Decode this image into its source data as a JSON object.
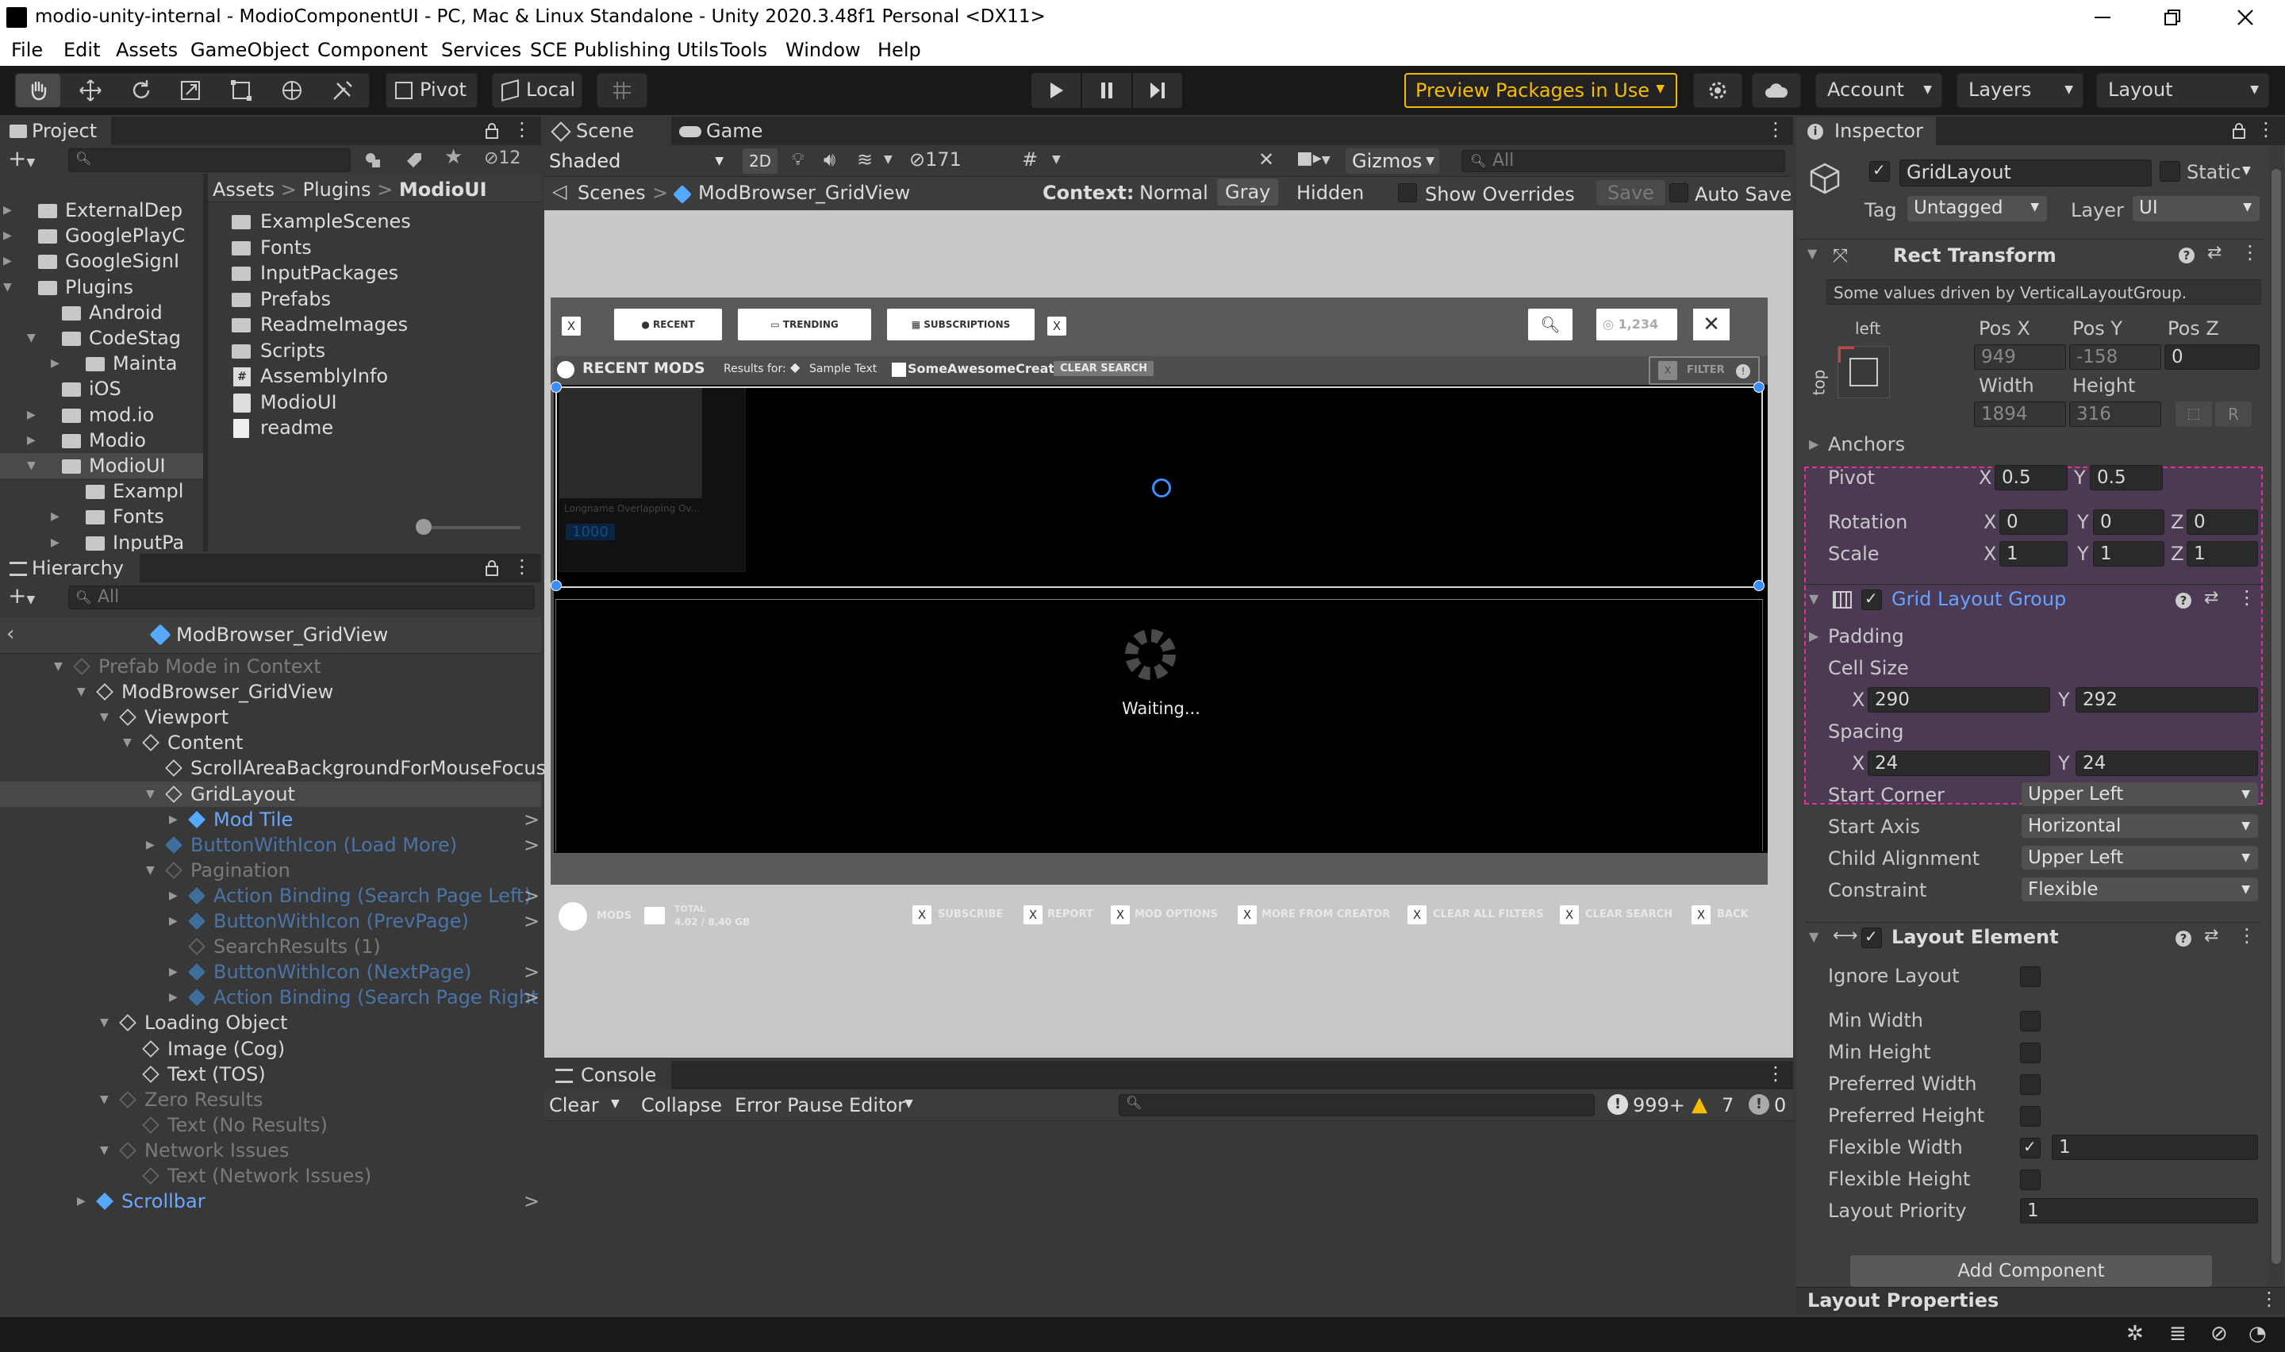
{
  "window": {
    "title": "modio-unity-internal - ModioComponentUI - PC, Mac & Linux Standalone - Unity 2020.3.48f1 Personal <DX11>"
  },
  "menu": [
    "File",
    "Edit",
    "Assets",
    "GameObject",
    "Component",
    "Services",
    "SCE Publishing Utils",
    "Tools",
    "Window",
    "Help"
  ],
  "toolbar": {
    "pivot": "Pivot",
    "local": "Local",
    "preview_packages": "Preview Packages in Use",
    "account": "Account",
    "layers": "Layers",
    "layout": "Layout",
    "accent": "#f4bc02"
  },
  "project": {
    "tab": "Project",
    "hidden_count": "12",
    "tree": [
      {
        "label": "ExternalDep",
        "indent": 0,
        "arrow": "right"
      },
      {
        "label": "GooglePlayC",
        "indent": 0,
        "arrow": "right"
      },
      {
        "label": "GoogleSignI",
        "indent": 0,
        "arrow": "right"
      },
      {
        "label": "Plugins",
        "indent": 0,
        "arrow": "down"
      },
      {
        "label": "Android",
        "indent": 1,
        "arrow": ""
      },
      {
        "label": "CodeStag",
        "indent": 1,
        "arrow": "down"
      },
      {
        "label": "Mainta",
        "indent": 2,
        "arrow": "right"
      },
      {
        "label": "iOS",
        "indent": 1,
        "arrow": ""
      },
      {
        "label": "mod.io",
        "indent": 1,
        "arrow": "right"
      },
      {
        "label": "Modio",
        "indent": 1,
        "arrow": "right"
      },
      {
        "label": "ModioUI",
        "indent": 1,
        "arrow": "down",
        "selected": true
      },
      {
        "label": "Exampl",
        "indent": 2,
        "arrow": ""
      },
      {
        "label": "Fonts",
        "indent": 2,
        "arrow": "right"
      },
      {
        "label": "InputPa",
        "indent": 2,
        "arrow": "right"
      }
    ],
    "breadcrumb": [
      "Assets",
      "Plugins",
      "ModioUI"
    ],
    "files": [
      {
        "label": "ExampleScenes",
        "icon": "folder-icon"
      },
      {
        "label": "Fonts",
        "icon": "folder-icon"
      },
      {
        "label": "InputPackages",
        "icon": "folder-icon"
      },
      {
        "label": "Prefabs",
        "icon": "folder-icon"
      },
      {
        "label": "ReadmeImages",
        "icon": "folder-icon"
      },
      {
        "label": "Scripts",
        "icon": "folder-icon"
      },
      {
        "label": "AssemblyInfo",
        "icon": "csharp-script-icon"
      },
      {
        "label": "ModioUI",
        "icon": "asset-icon"
      },
      {
        "label": "readme",
        "icon": "text-file-icon"
      }
    ]
  },
  "hierarchy": {
    "tab": "Hierarchy",
    "search_placeholder": "All",
    "root": "ModBrowser_GridView",
    "items": [
      {
        "label": "Prefab Mode in Context",
        "indent": 0,
        "arrow": "down",
        "style": "dim"
      },
      {
        "label": "ModBrowser_GridView",
        "indent": 1,
        "arrow": "down",
        "style": "normal"
      },
      {
        "label": "Viewport",
        "indent": 2,
        "arrow": "down",
        "style": "normal"
      },
      {
        "label": "Content",
        "indent": 3,
        "arrow": "down",
        "style": "normal"
      },
      {
        "label": "ScrollAreaBackgroundForMouseFocus",
        "indent": 4,
        "arrow": "",
        "style": "normal"
      },
      {
        "label": "GridLayout",
        "indent": 4,
        "arrow": "down",
        "style": "selected"
      },
      {
        "label": "Mod Tile",
        "indent": 5,
        "arrow": "right",
        "style": "prefab",
        "chev": true
      },
      {
        "label": "ButtonWithIcon (Load More)",
        "indent": 4,
        "arrow": "right",
        "style": "prefab-dim",
        "chev": true
      },
      {
        "label": "Pagination",
        "indent": 4,
        "arrow": "down",
        "style": "dim"
      },
      {
        "label": "Action Binding (Search Page Left)",
        "indent": 5,
        "arrow": "right",
        "style": "prefab-dim",
        "chev": true
      },
      {
        "label": "ButtonWithIcon (PrevPage)",
        "indent": 5,
        "arrow": "right",
        "style": "prefab-dim",
        "chev": true
      },
      {
        "label": "SearchResults (1)",
        "indent": 5,
        "arrow": "",
        "style": "dim"
      },
      {
        "label": "ButtonWithIcon (NextPage)",
        "indent": 5,
        "arrow": "right",
        "style": "prefab-dim",
        "chev": true
      },
      {
        "label": "Action Binding (Search Page Right",
        "indent": 5,
        "arrow": "right",
        "style": "prefab-dim",
        "chev": true
      },
      {
        "label": "Loading Object",
        "indent": 2,
        "arrow": "down",
        "style": "normal"
      },
      {
        "label": "Image (Cog)",
        "indent": 3,
        "arrow": "",
        "style": "normal"
      },
      {
        "label": "Text (TOS)",
        "indent": 3,
        "arrow": "",
        "style": "normal"
      },
      {
        "label": "Zero Results",
        "indent": 2,
        "arrow": "down",
        "style": "dim"
      },
      {
        "label": "Text (No Results)",
        "indent": 3,
        "arrow": "",
        "style": "dim"
      },
      {
        "label": "Network Issues",
        "indent": 2,
        "arrow": "down",
        "style": "dim"
      },
      {
        "label": "Text (Network Issues)",
        "indent": 3,
        "arrow": "",
        "style": "dim"
      },
      {
        "label": "Scrollbar",
        "indent": 1,
        "arrow": "right",
        "style": "prefab",
        "chev": true
      }
    ]
  },
  "scene": {
    "tab_scene": "Scene",
    "tab_game": "Game",
    "shading": "Shaded",
    "mode_2d": "2D",
    "hidden_objects": "171",
    "gizmos": "Gizmos",
    "search_placeholder": "All",
    "breadcrumb_root": "Scenes",
    "breadcrumb_prefab": "ModBrowser_GridView",
    "context_label": "Context:",
    "context_normal": "Normal",
    "context_gray": "Gray",
    "context_hidden": "Hidden",
    "show_overrides": "Show Overrides",
    "save": "Save",
    "auto_save": "Auto Save",
    "game": {
      "tabs": [
        "RECENT",
        "TRENDING",
        "SUBSCRIPTIONS"
      ],
      "counter": "1,234",
      "heading": "RECENT MODS",
      "results_for": "Results for:",
      "tag_text": "Sample Text",
      "creator_text": "SomeAwesomeCreator",
      "clear_search": "CLEAR SEARCH",
      "filter": "FILTER",
      "tile_title": "Longname Overlapping Ov...",
      "tile_price": "1000",
      "waiting": "Waiting...",
      "bottom": {
        "mods": "MODS",
        "total_label": "TOTAL",
        "total_value": "4.02 / 8.40 GB",
        "actions": [
          "SUBSCRIBE",
          "REPORT",
          "MOD OPTIONS",
          "MORE FROM CREATOR",
          "CLEAR ALL FILTERS",
          "CLEAR SEARCH",
          "BACK"
        ]
      }
    }
  },
  "console": {
    "tab": "Console",
    "clear": "Clear",
    "collapse": "Collapse",
    "error_pause": "Error Pause",
    "editor": "Editor",
    "count_info": "999+",
    "count_warn": "7",
    "count_error": "0"
  },
  "inspector": {
    "tab": "Inspector",
    "object_name": "GridLayout",
    "static_label": "Static",
    "tag_label": "Tag",
    "tag_value": "Untagged",
    "layer_label": "Layer",
    "layer_value": "UI",
    "rect_transform": {
      "title": "Rect Transform",
      "note": "Some values driven by VerticalLayoutGroup.",
      "anchor_h": "left",
      "anchor_v": "top",
      "posx_label": "Pos X",
      "posy_label": "Pos Y",
      "posz_label": "Pos Z",
      "posx": "949",
      "posy": "-158",
      "posz": "0",
      "width_label": "Width",
      "height_label": "Height",
      "width": "1894",
      "height": "316",
      "r_button": "R",
      "anchors": "Anchors",
      "pivot_label": "Pivot",
      "pivot_x": "0.5",
      "pivot_y": "0.5",
      "rotation_label": "Rotation",
      "rot_x": "0",
      "rot_y": "0",
      "rot_z": "0",
      "scale_label": "Scale",
      "scale_x": "1",
      "scale_y": "1",
      "scale_z": "1"
    },
    "grid_layout": {
      "title": "Grid Layout Group",
      "padding": "Padding",
      "cell_size": "Cell Size",
      "cell_x": "290",
      "cell_y": "292",
      "spacing": "Spacing",
      "spacing_x": "24",
      "spacing_y": "24",
      "start_corner_label": "Start Corner",
      "start_corner": "Upper Left",
      "start_axis_label": "Start Axis",
      "start_axis": "Horizontal",
      "child_alignment_label": "Child Alignment",
      "child_alignment": "Upper Left",
      "constraint_label": "Constraint",
      "constraint": "Flexible"
    },
    "layout_element": {
      "title": "Layout Element",
      "ignore_layout": "Ignore Layout",
      "min_width": "Min Width",
      "min_height": "Min Height",
      "preferred_width": "Preferred Width",
      "preferred_height": "Preferred Height",
      "flexible_width": "Flexible Width",
      "flexible_width_value": "1",
      "flexible_height": "Flexible Height",
      "layout_priority": "Layout Priority",
      "layout_priority_value": "1"
    },
    "add_component": "Add Component",
    "layout_properties": "Layout Properties",
    "axis_x": "X",
    "axis_y": "Y",
    "axis_z": "Z",
    "highlight_color": "#e0309a"
  }
}
